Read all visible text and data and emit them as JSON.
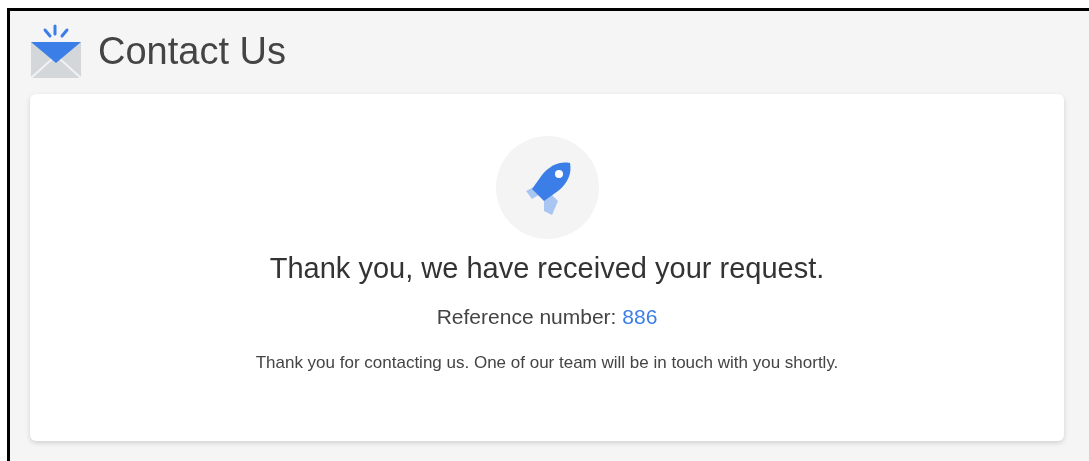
{
  "page": {
    "title": "Contact Us"
  },
  "confirmation": {
    "heading": "Thank you, we have received your request.",
    "reference_label": "Reference number:",
    "reference_number": "886",
    "message": "Thank you for contacting us. One of our team will be in touch with you shortly."
  }
}
